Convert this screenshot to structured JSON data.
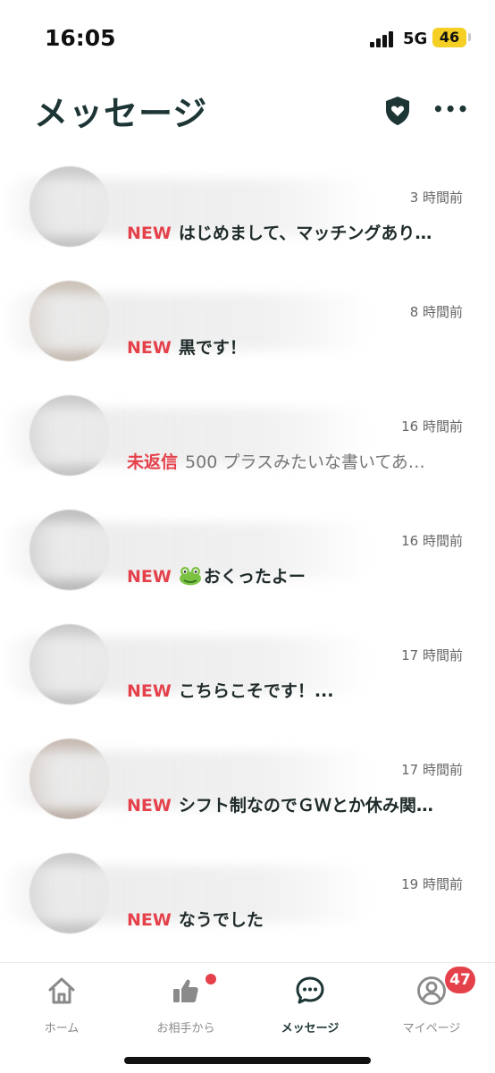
{
  "status_bar": {
    "time": "16:05",
    "network": "5G",
    "battery": "46"
  },
  "header": {
    "title": "メッセージ",
    "more_label": "•••"
  },
  "messages": [
    {
      "time": "3 時間前",
      "tag": "NEW",
      "preview": "はじめまして、マッチングあり…",
      "muted": false
    },
    {
      "time": "8 時間前",
      "tag": "NEW",
      "preview": "黒です！",
      "muted": false
    },
    {
      "time": "16 時間前",
      "tag": "未返信",
      "preview": "500 プラスみたいな書いてあ…",
      "muted": true
    },
    {
      "time": "16 時間前",
      "tag": "NEW",
      "preview": "おくったよー",
      "muted": false,
      "emoji": "frog"
    },
    {
      "time": "17 時間前",
      "tag": "NEW",
      "preview": "こちらこそです！...",
      "muted": false
    },
    {
      "time": "17 時間前",
      "tag": "NEW",
      "preview": "シフト制なのでＧＷとか休み関…",
      "muted": false
    },
    {
      "time": "19 時間前",
      "tag": "NEW",
      "preview": "なうでした",
      "muted": false
    }
  ],
  "tabs": [
    {
      "label": "ホーム",
      "icon": "home-icon"
    },
    {
      "label": "お相手から",
      "icon": "thumbs-up-icon"
    },
    {
      "label": "メッセージ",
      "icon": "chat-bubble-icon"
    },
    {
      "label": "マイページ",
      "icon": "user-circle-icon",
      "badge": "47"
    }
  ],
  "colors": {
    "accent_red": "#e5414b",
    "title_dark": "#1d3535",
    "battery_yellow": "#f5cf24"
  }
}
